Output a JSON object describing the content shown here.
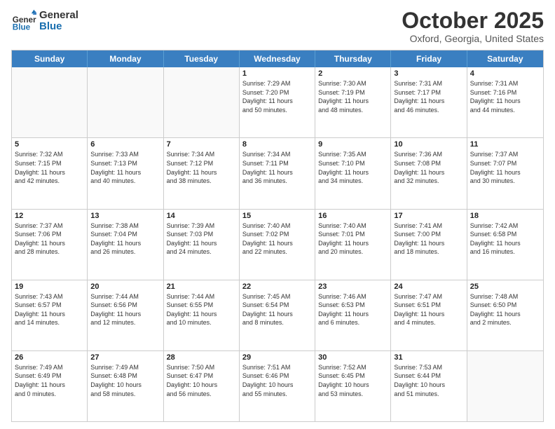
{
  "logo": {
    "general": "General",
    "blue": "Blue"
  },
  "title": "October 2025",
  "subtitle": "Oxford, Georgia, United States",
  "header_days": [
    "Sunday",
    "Monday",
    "Tuesday",
    "Wednesday",
    "Thursday",
    "Friday",
    "Saturday"
  ],
  "rows": [
    [
      {
        "day": "",
        "info": ""
      },
      {
        "day": "",
        "info": ""
      },
      {
        "day": "",
        "info": ""
      },
      {
        "day": "1",
        "info": "Sunrise: 7:29 AM\nSunset: 7:20 PM\nDaylight: 11 hours\nand 50 minutes."
      },
      {
        "day": "2",
        "info": "Sunrise: 7:30 AM\nSunset: 7:19 PM\nDaylight: 11 hours\nand 48 minutes."
      },
      {
        "day": "3",
        "info": "Sunrise: 7:31 AM\nSunset: 7:17 PM\nDaylight: 11 hours\nand 46 minutes."
      },
      {
        "day": "4",
        "info": "Sunrise: 7:31 AM\nSunset: 7:16 PM\nDaylight: 11 hours\nand 44 minutes."
      }
    ],
    [
      {
        "day": "5",
        "info": "Sunrise: 7:32 AM\nSunset: 7:15 PM\nDaylight: 11 hours\nand 42 minutes."
      },
      {
        "day": "6",
        "info": "Sunrise: 7:33 AM\nSunset: 7:13 PM\nDaylight: 11 hours\nand 40 minutes."
      },
      {
        "day": "7",
        "info": "Sunrise: 7:34 AM\nSunset: 7:12 PM\nDaylight: 11 hours\nand 38 minutes."
      },
      {
        "day": "8",
        "info": "Sunrise: 7:34 AM\nSunset: 7:11 PM\nDaylight: 11 hours\nand 36 minutes."
      },
      {
        "day": "9",
        "info": "Sunrise: 7:35 AM\nSunset: 7:10 PM\nDaylight: 11 hours\nand 34 minutes."
      },
      {
        "day": "10",
        "info": "Sunrise: 7:36 AM\nSunset: 7:08 PM\nDaylight: 11 hours\nand 32 minutes."
      },
      {
        "day": "11",
        "info": "Sunrise: 7:37 AM\nSunset: 7:07 PM\nDaylight: 11 hours\nand 30 minutes."
      }
    ],
    [
      {
        "day": "12",
        "info": "Sunrise: 7:37 AM\nSunset: 7:06 PM\nDaylight: 11 hours\nand 28 minutes."
      },
      {
        "day": "13",
        "info": "Sunrise: 7:38 AM\nSunset: 7:04 PM\nDaylight: 11 hours\nand 26 minutes."
      },
      {
        "day": "14",
        "info": "Sunrise: 7:39 AM\nSunset: 7:03 PM\nDaylight: 11 hours\nand 24 minutes."
      },
      {
        "day": "15",
        "info": "Sunrise: 7:40 AM\nSunset: 7:02 PM\nDaylight: 11 hours\nand 22 minutes."
      },
      {
        "day": "16",
        "info": "Sunrise: 7:40 AM\nSunset: 7:01 PM\nDaylight: 11 hours\nand 20 minutes."
      },
      {
        "day": "17",
        "info": "Sunrise: 7:41 AM\nSunset: 7:00 PM\nDaylight: 11 hours\nand 18 minutes."
      },
      {
        "day": "18",
        "info": "Sunrise: 7:42 AM\nSunset: 6:58 PM\nDaylight: 11 hours\nand 16 minutes."
      }
    ],
    [
      {
        "day": "19",
        "info": "Sunrise: 7:43 AM\nSunset: 6:57 PM\nDaylight: 11 hours\nand 14 minutes."
      },
      {
        "day": "20",
        "info": "Sunrise: 7:44 AM\nSunset: 6:56 PM\nDaylight: 11 hours\nand 12 minutes."
      },
      {
        "day": "21",
        "info": "Sunrise: 7:44 AM\nSunset: 6:55 PM\nDaylight: 11 hours\nand 10 minutes."
      },
      {
        "day": "22",
        "info": "Sunrise: 7:45 AM\nSunset: 6:54 PM\nDaylight: 11 hours\nand 8 minutes."
      },
      {
        "day": "23",
        "info": "Sunrise: 7:46 AM\nSunset: 6:53 PM\nDaylight: 11 hours\nand 6 minutes."
      },
      {
        "day": "24",
        "info": "Sunrise: 7:47 AM\nSunset: 6:51 PM\nDaylight: 11 hours\nand 4 minutes."
      },
      {
        "day": "25",
        "info": "Sunrise: 7:48 AM\nSunset: 6:50 PM\nDaylight: 11 hours\nand 2 minutes."
      }
    ],
    [
      {
        "day": "26",
        "info": "Sunrise: 7:49 AM\nSunset: 6:49 PM\nDaylight: 11 hours\nand 0 minutes."
      },
      {
        "day": "27",
        "info": "Sunrise: 7:49 AM\nSunset: 6:48 PM\nDaylight: 10 hours\nand 58 minutes."
      },
      {
        "day": "28",
        "info": "Sunrise: 7:50 AM\nSunset: 6:47 PM\nDaylight: 10 hours\nand 56 minutes."
      },
      {
        "day": "29",
        "info": "Sunrise: 7:51 AM\nSunset: 6:46 PM\nDaylight: 10 hours\nand 55 minutes."
      },
      {
        "day": "30",
        "info": "Sunrise: 7:52 AM\nSunset: 6:45 PM\nDaylight: 10 hours\nand 53 minutes."
      },
      {
        "day": "31",
        "info": "Sunrise: 7:53 AM\nSunset: 6:44 PM\nDaylight: 10 hours\nand 51 minutes."
      },
      {
        "day": "",
        "info": ""
      }
    ]
  ]
}
